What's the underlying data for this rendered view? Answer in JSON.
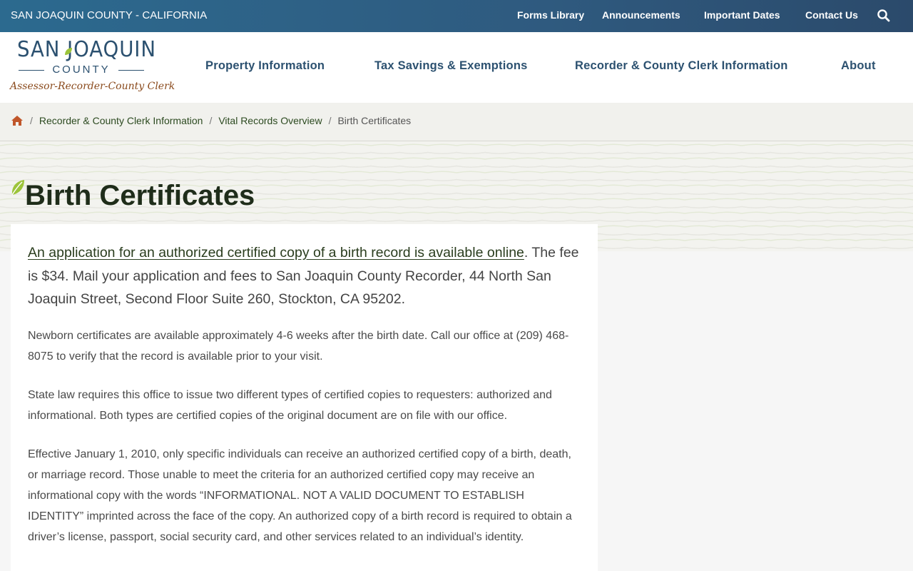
{
  "topbar": {
    "county": "SAN JOAQUIN COUNTY - CALIFORNIA",
    "links": [
      "Forms Library",
      "Announcements",
      "Important Dates",
      "Contact Us"
    ]
  },
  "logo": {
    "main": "SAN JOAQUIN",
    "county": "COUNTY",
    "sub": "Assessor-Recorder-County Clerk"
  },
  "nav": {
    "items": [
      "Property Information",
      "Tax Savings & Exemptions",
      "Recorder & County Clerk Information",
      "About"
    ]
  },
  "breadcrumb": {
    "items": [
      "Recorder & County Clerk Information",
      "Vital Records Overview"
    ],
    "current": "Birth Certificates"
  },
  "page": {
    "title": "Birth Certificates"
  },
  "content": {
    "lead_link": "An application for an authorized certified copy of a birth record is available online",
    "lead_rest": ". The fee is $34. Mail your application and fees to San Joaquin County Recorder, 44 North San Joaquin Street, Second Floor Suite 260, Stockton, CA 95202.",
    "paragraphs": [
      "Newborn certificates are available approximately 4-6 weeks after the birth date. Call our office at (209) 468-8075 to verify that the record is available prior to your visit.",
      "State law requires this office to issue two different types of certified copies to requesters: authorized and informational. Both types are certified copies of the original document are on file with our office.",
      "Effective January 1, 2010, only specific individuals can receive an authorized certified copy of a birth, death, or marriage record. Those unable to meet the criteria for an authorized certified copy may receive an informational copy with the words “INFORMATIONAL. NOT A VALID DOCUMENT TO ESTABLISH IDENTITY” imprinted across the face of the copy. An authorized copy of a birth record is required to obtain a driver’s license, passport, social security card, and other services related to an individual’s identity."
    ]
  },
  "colors": {
    "topbar": "#2f5a7f",
    "nav_text": "#2c5170",
    "accent_leaf": "#9cc43a",
    "home_icon": "#c0562a",
    "title": "#1f2d1a"
  },
  "icons": {
    "search": "search-icon",
    "home": "home-icon",
    "leaf": "leaf-icon"
  }
}
